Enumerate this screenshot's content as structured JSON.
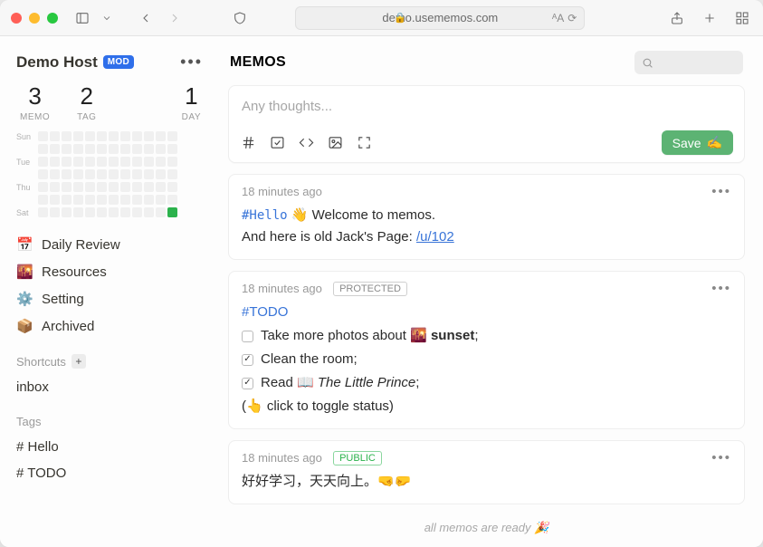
{
  "browser": {
    "url": "demo.usememos.com"
  },
  "sidebar": {
    "host_name": "Demo Host",
    "host_badge": "MOD",
    "stats": [
      {
        "value": "3",
        "label": "MEMO"
      },
      {
        "value": "2",
        "label": "TAG"
      },
      {
        "value": "1",
        "label": "DAY"
      }
    ],
    "heatmap_days": [
      "Sun",
      "Tue",
      "Thu",
      "Sat"
    ],
    "nav": [
      {
        "emoji": "📅",
        "label": "Daily Review"
      },
      {
        "emoji": "🌇",
        "label": "Resources"
      },
      {
        "emoji": "⚙️",
        "label": "Setting"
      },
      {
        "emoji": "📦",
        "label": "Archived"
      }
    ],
    "shortcuts_label": "Shortcuts",
    "shortcuts": [
      {
        "label": "inbox"
      }
    ],
    "tags_label": "Tags",
    "tags": [
      {
        "label": "# Hello"
      },
      {
        "label": "# TODO"
      }
    ]
  },
  "main": {
    "title": "MEMOS",
    "composer": {
      "placeholder": "Any thoughts...",
      "save_label": "Save",
      "save_emoji": "✍️"
    },
    "memos": [
      {
        "time": "18 minutes ago",
        "visibility": null,
        "tag": "#Hello",
        "wave": "👋",
        "text_after_tag": " Welcome to memos.",
        "line2_prefix": "And here is old Jack's Page: ",
        "line2_link": "/u/102"
      },
      {
        "time": "18 minutes ago",
        "visibility": "PROTECTED",
        "tag": "#TODO",
        "todos": [
          {
            "done": false,
            "prefix": "Take more photos about ",
            "emoji": "🌇",
            "bold": "sunset",
            "suffix": ";"
          },
          {
            "done": true,
            "text": "Clean the room;"
          },
          {
            "done": true,
            "prefix": "Read ",
            "emoji": "📖",
            "italic": "The Little Prince",
            "suffix": ";"
          }
        ],
        "hint": "(👆 click to toggle status)"
      },
      {
        "time": "18 minutes ago",
        "visibility": "PUBLIC",
        "text": "好好学习，天天向上。🤜🤛"
      }
    ],
    "footer": "all memos are ready 🎉"
  }
}
